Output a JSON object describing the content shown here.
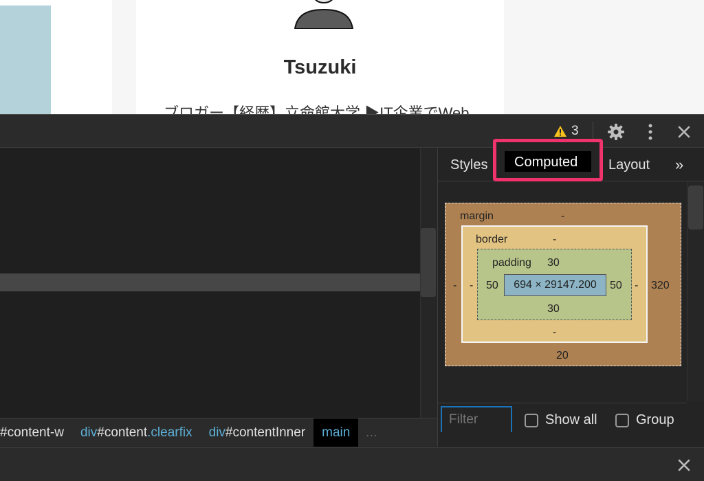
{
  "page": {
    "profile_name": "Tsuzuki",
    "profile_bio": "ブロガー【経歴】立命館大学 ▶IT企業でWeb"
  },
  "toolbar": {
    "warning_count": "3",
    "icons": [
      "warning-icon",
      "gear-icon",
      "kebab-menu-icon",
      "close-icon"
    ]
  },
  "sidebar": {
    "tabs": [
      {
        "label": "Styles"
      },
      {
        "label": "Computed",
        "selected": true
      },
      {
        "label": "Layout"
      }
    ],
    "more_tabs_label": "»"
  },
  "box_model": {
    "margin": {
      "label": "margin",
      "top": "-",
      "right": "320",
      "bottom": "20",
      "left": "-"
    },
    "border": {
      "label": "border",
      "top": "-",
      "right": "-",
      "bottom": "-",
      "left": "-"
    },
    "padding": {
      "label": "padding",
      "top": "30",
      "right": "50",
      "bottom": "30",
      "left": "50"
    },
    "content": "694 × 29147.200"
  },
  "filter": {
    "placeholder": "Filter",
    "show_all_label": "Show all",
    "group_label": "Group"
  },
  "breadcrumbs": [
    {
      "tag": "",
      "id": "#content-w",
      "cls": ""
    },
    {
      "tag": "div",
      "id": "#content",
      "cls": ".clearfix"
    },
    {
      "tag": "div",
      "id": "#contentInner",
      "cls": ""
    },
    {
      "tag": "main",
      "id": "",
      "cls": "",
      "active": true
    }
  ],
  "breadcrumb_more": "…",
  "colors": {
    "highlight_box": "#f0336d",
    "margin": "#ae8152",
    "border": "#e3c381",
    "padding": "#b7c48a",
    "content": "#8cb4c4"
  }
}
